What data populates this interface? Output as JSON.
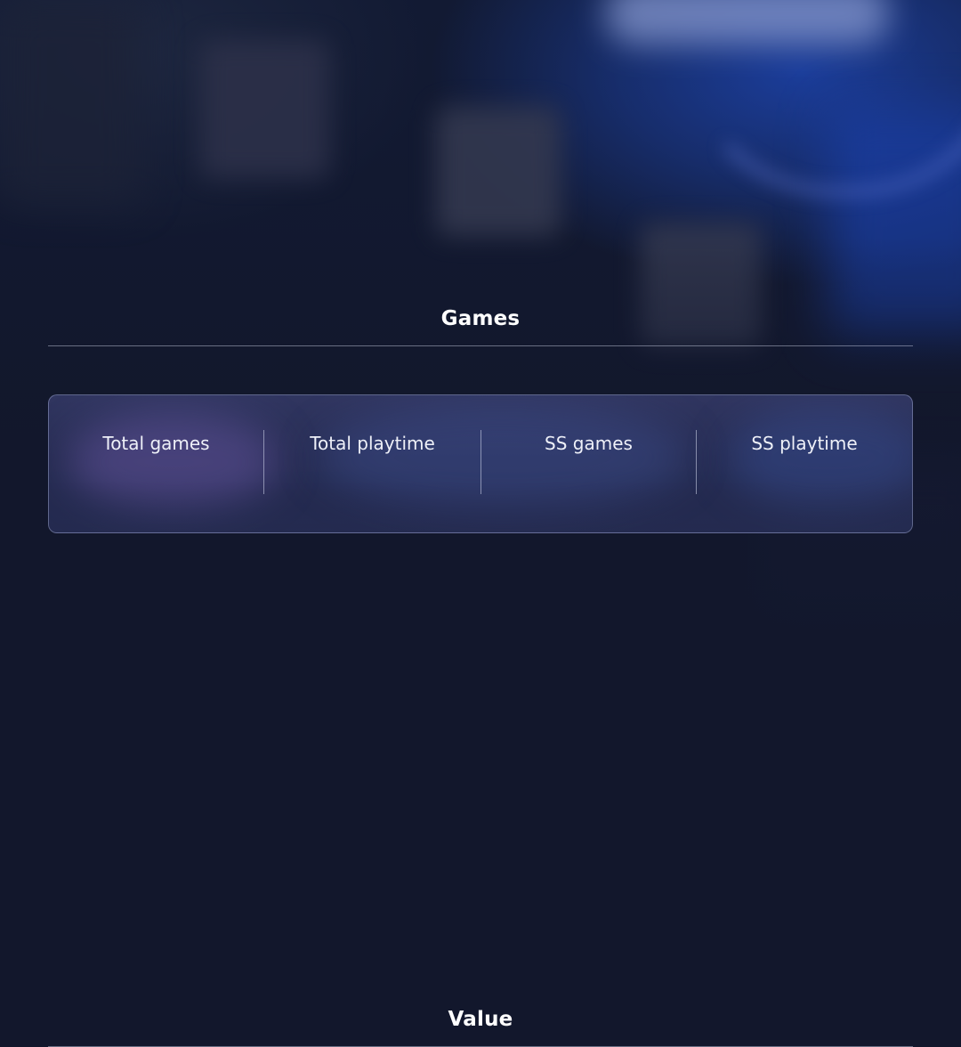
{
  "sections": {
    "games": {
      "title": "Games",
      "stats": [
        {
          "label": "Total games"
        },
        {
          "label": "Total playtime"
        },
        {
          "label": "SS games"
        },
        {
          "label": "SS playtime"
        }
      ]
    },
    "value": {
      "title": "Value"
    }
  },
  "colors": {
    "background": "#12172c",
    "accent_blue": "#1b3d9a",
    "card_border": "#aab4dc",
    "text": "#ffffff"
  }
}
